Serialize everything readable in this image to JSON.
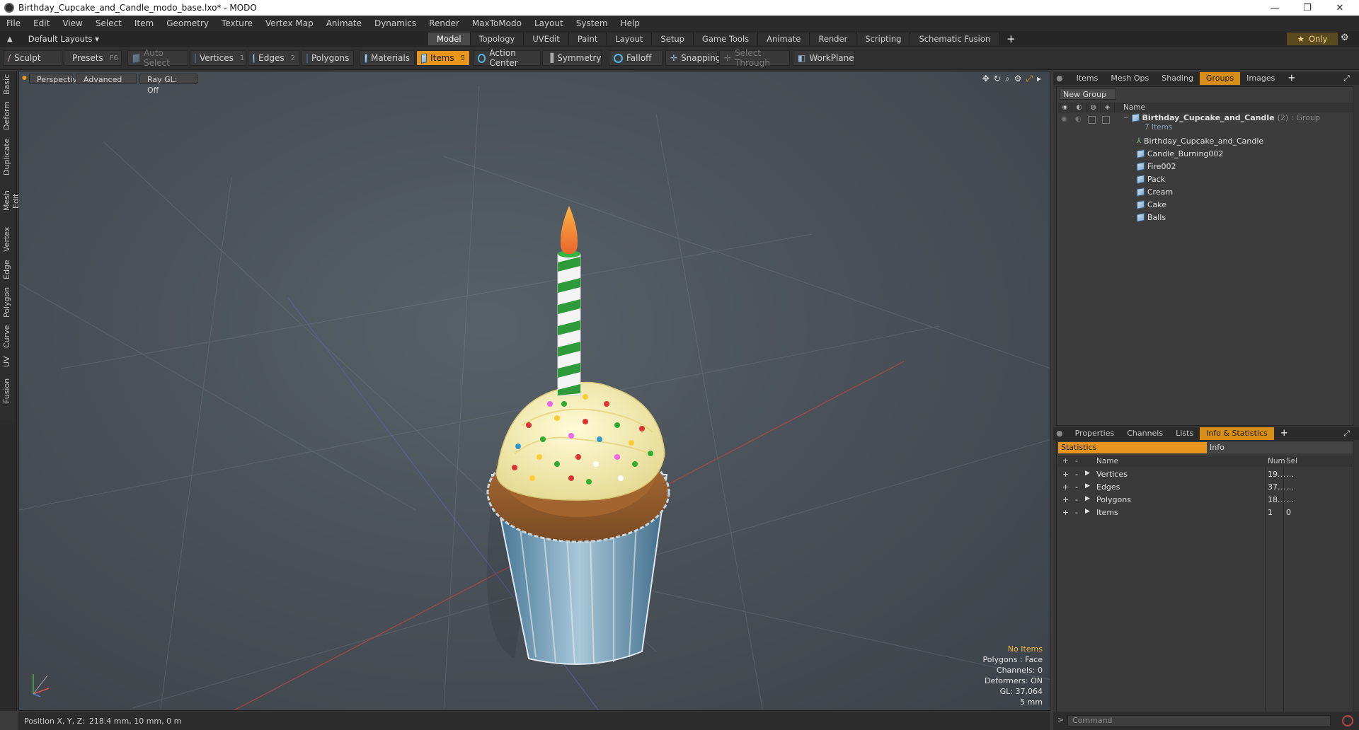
{
  "window": {
    "title": "Birthday_Cupcake_and_Candle_modo_base.lxo* - MODO"
  },
  "menu": [
    "File",
    "Edit",
    "View",
    "Select",
    "Item",
    "Geometry",
    "Texture",
    "Vertex Map",
    "Animate",
    "Dynamics",
    "Render",
    "MaxToModo",
    "Layout",
    "System",
    "Help"
  ],
  "layout_selector": "Default Layouts",
  "layout_tabs": [
    "Model",
    "Topology",
    "UVEdit",
    "Paint",
    "Layout",
    "Setup",
    "Game Tools",
    "Animate",
    "Render",
    "Scripting",
    "Schematic Fusion"
  ],
  "active_layout_tab": "Model",
  "only_label": "Only",
  "toolbar": {
    "sculpt": "Sculpt",
    "presets": "Presets",
    "presets_key": "F6",
    "auto_select": "Auto Select",
    "vertices": "Vertices",
    "vertices_key": "1",
    "edges": "Edges",
    "edges_key": "2",
    "polygons": "Polygons",
    "materials": "Materials",
    "items": "Items",
    "items_key": "5",
    "action_center": "Action Center",
    "symmetry": "Symmetry",
    "falloff": "Falloff",
    "snapping": "Snapping",
    "select_through": "Select Through",
    "workplane": "WorkPlane"
  },
  "left_tabs": [
    "Basic",
    "Deform",
    "Duplicate",
    "Mesh Edit",
    "Vertex",
    "Edge",
    "Polygon",
    "Curve",
    "UV",
    "Fusion"
  ],
  "viewport": {
    "perspective": "Perspective",
    "advanced": "Advanced",
    "raygl": "Ray GL: Off",
    "hud": {
      "no_items": "No Items",
      "polygons": "Polygons : Face",
      "channels": "Channels: 0",
      "deformers": "Deformers: ON",
      "gl": "GL: 37,064",
      "scale": "5 mm"
    }
  },
  "status": {
    "label": "Position X, Y, Z:",
    "value": "218.4 mm, 10 mm, 0 m"
  },
  "right_top_tabs": [
    "Items",
    "Mesh Ops",
    "Shading",
    "Groups",
    "Images"
  ],
  "right_top_active": "Groups",
  "groups": {
    "new_group": "New Group",
    "name_header": "Name",
    "root": {
      "name": "Birthday_Cupcake_and_Candle",
      "count": "(2)",
      "type": ": Group",
      "sub": "7 Items"
    },
    "children": [
      "Birthday_Cupcake_and_Candle",
      "Candle_Burning002",
      "Fire002",
      "Pack",
      "Cream",
      "Cake",
      "Balls"
    ]
  },
  "right_bottom_tabs": [
    "Properties",
    "Channels",
    "Lists",
    "Info & Statistics"
  ],
  "right_bottom_active": "Info & Statistics",
  "stats": {
    "tab_statistics": "Statistics",
    "tab_info": "Info",
    "headers": {
      "name": "Name",
      "num": "Num",
      "sel": "Sel"
    },
    "rows": [
      {
        "name": "Vertices",
        "num": "19…",
        "sel": "…"
      },
      {
        "name": "Edges",
        "num": "37…",
        "sel": "…"
      },
      {
        "name": "Polygons",
        "num": "18…",
        "sel": "…"
      },
      {
        "name": "Items",
        "num": "1",
        "sel": "0"
      }
    ]
  },
  "command": {
    "placeholder": "Command"
  },
  "colors": {
    "accent": "#e8951d",
    "group_tab": "#d88d17",
    "hud_warn": "#f2b93b"
  }
}
